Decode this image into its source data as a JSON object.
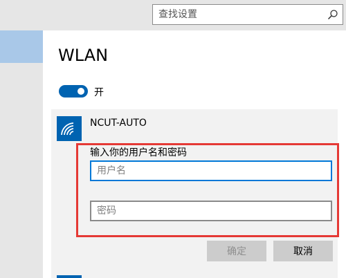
{
  "search": {
    "placeholder": "查找设置",
    "icon": "search-icon"
  },
  "page": {
    "title": "WLAN"
  },
  "wifi_toggle": {
    "state": "on",
    "label": "开",
    "color": "#0063b1"
  },
  "network": {
    "name": "NCUT-AUTO",
    "icon": "wifi-icon",
    "prompt": "输入你的用户名和密码",
    "username_placeholder": "用户名",
    "password_placeholder": "密码",
    "ok_label": "确定",
    "cancel_label": "取消"
  },
  "colors": {
    "accent": "#0063b1",
    "highlight": "#e53935",
    "focus": "#0078d7"
  }
}
